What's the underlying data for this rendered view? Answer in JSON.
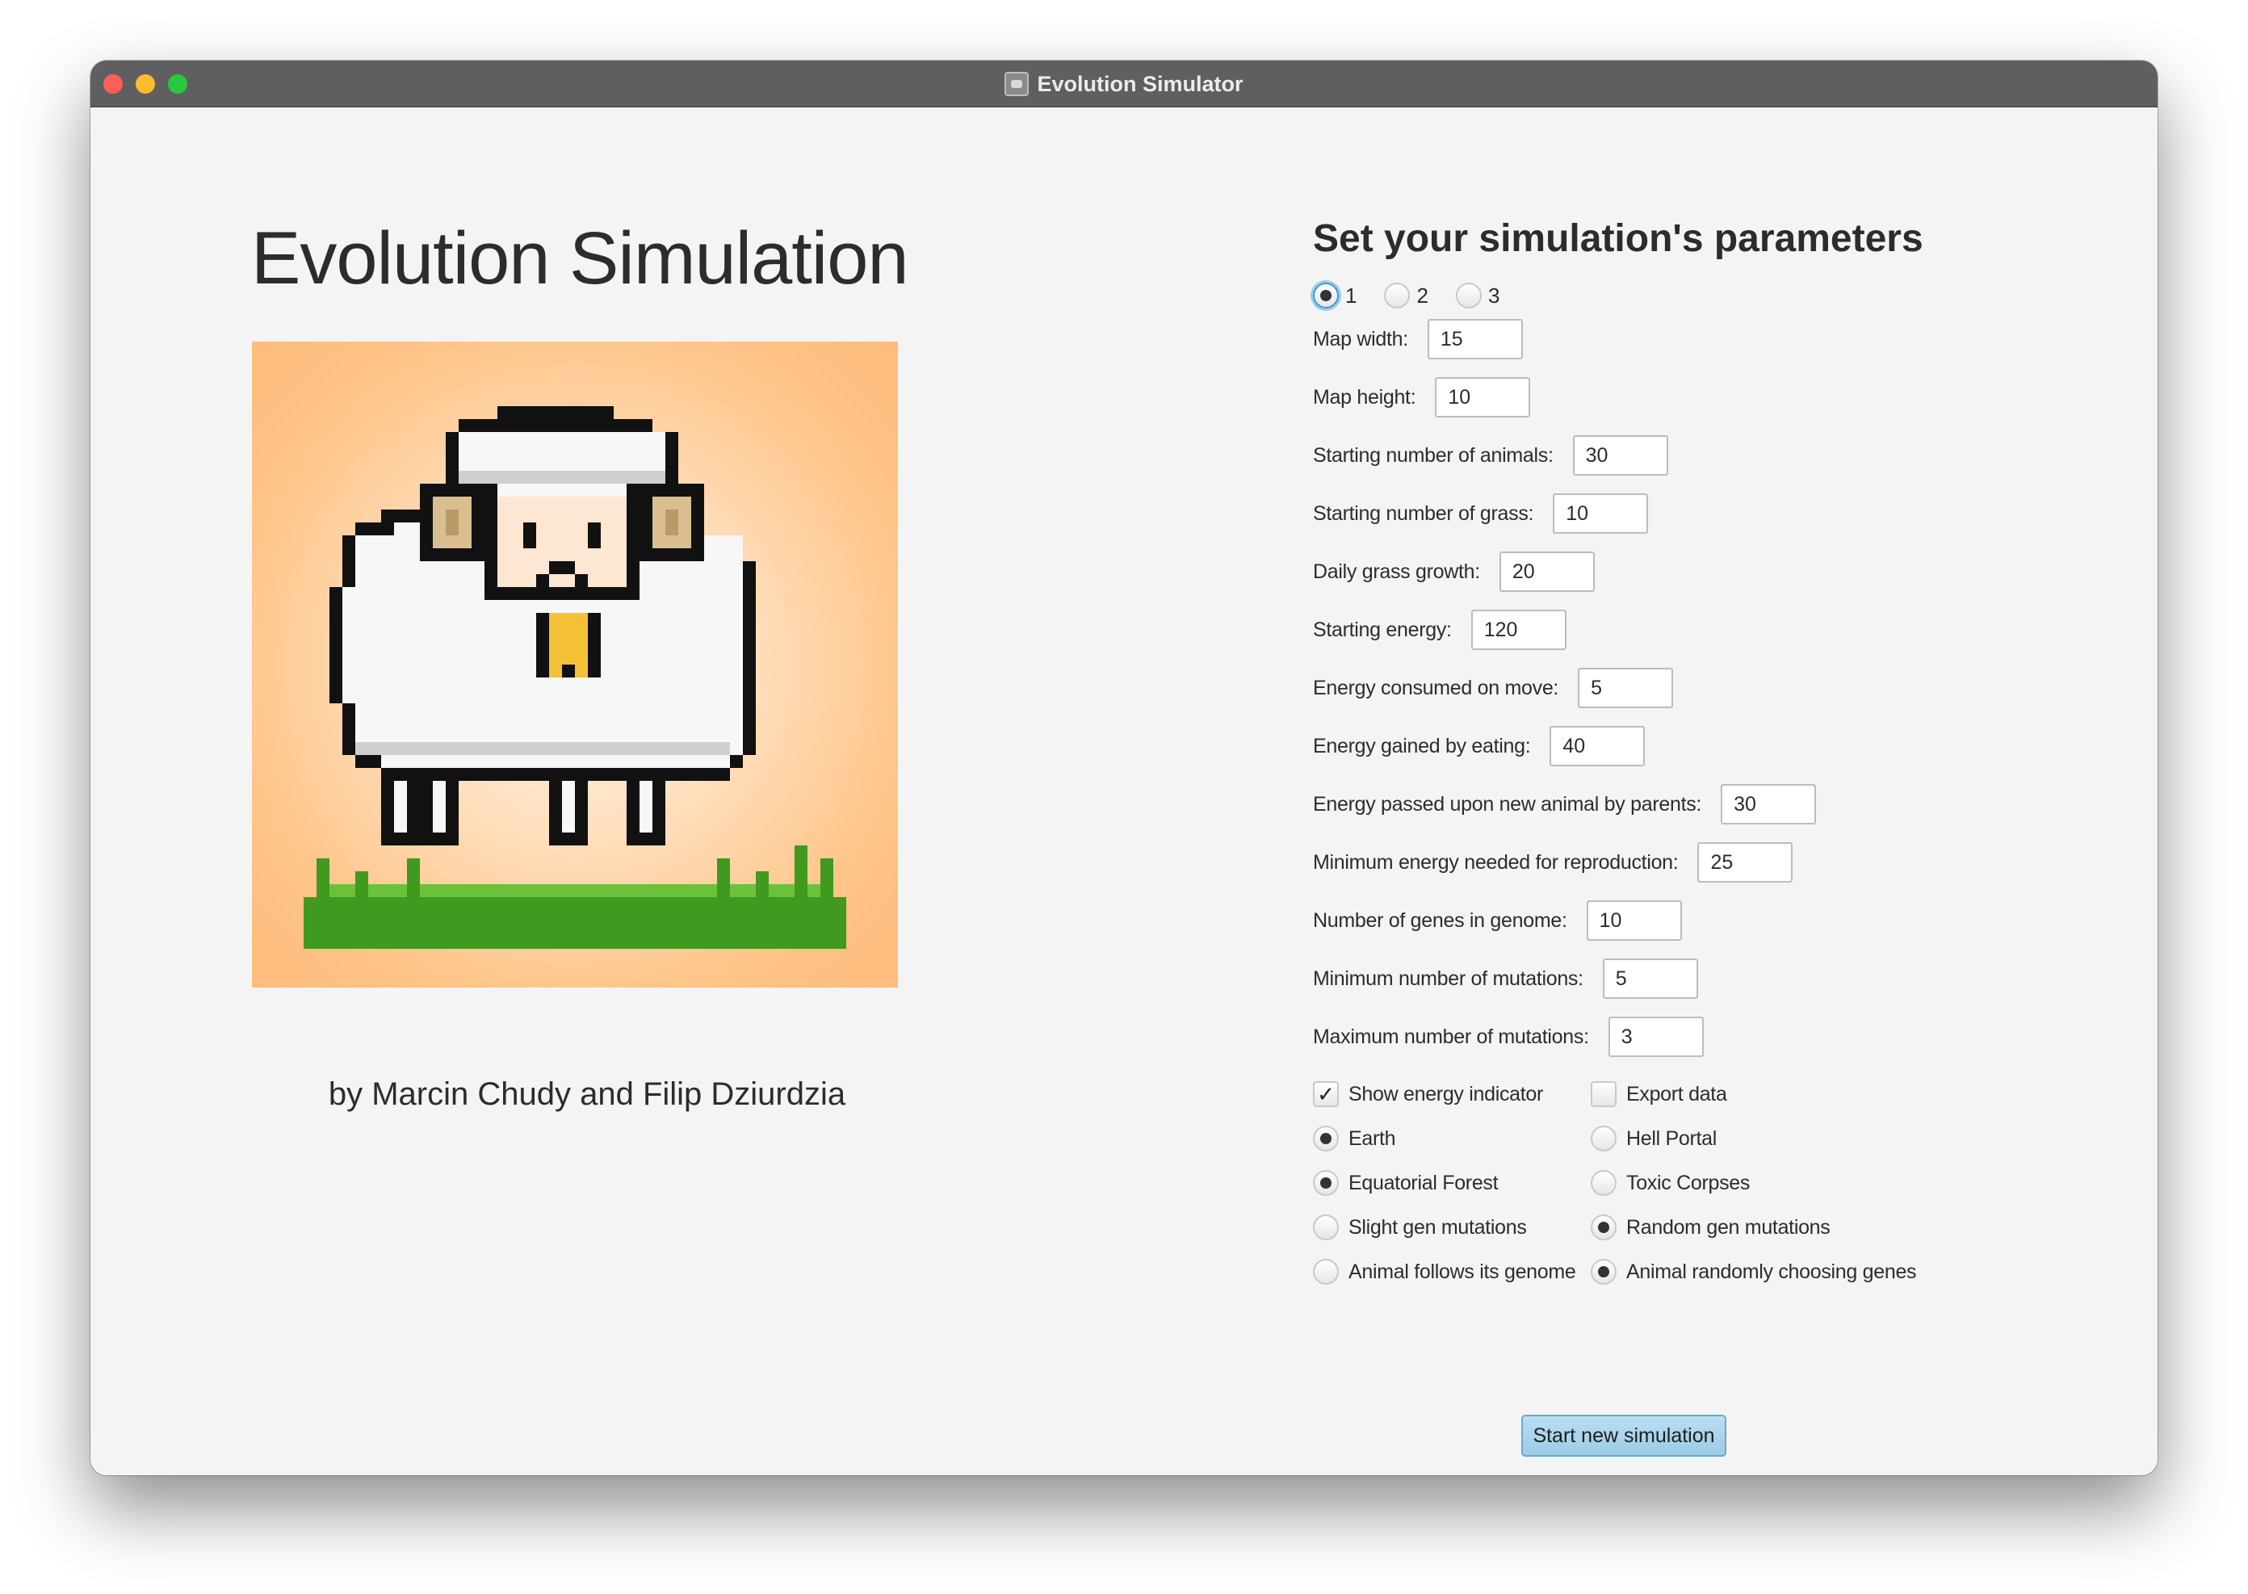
{
  "window": {
    "title": "Evolution Simulator"
  },
  "left": {
    "heading": "Evolution Simulation",
    "authors": "by Marcin Chudy and Filip Dziurdzia"
  },
  "params": {
    "heading": "Set your simulation's parameters",
    "presets": [
      {
        "label": "1",
        "selected": true
      },
      {
        "label": "2",
        "selected": false
      },
      {
        "label": "3",
        "selected": false
      }
    ],
    "fields": [
      {
        "label": "Map width:",
        "value": "15"
      },
      {
        "label": "Map height:",
        "value": "10"
      },
      {
        "label": "Starting number of animals:",
        "value": "30"
      },
      {
        "label": "Starting number of grass:",
        "value": "10"
      },
      {
        "label": "Daily grass growth:",
        "value": "20"
      },
      {
        "label": "Starting energy:",
        "value": "120"
      },
      {
        "label": "Energy consumed on move:",
        "value": "5"
      },
      {
        "label": "Energy gained by eating:",
        "value": "40"
      },
      {
        "label": "Energy passed upon new animal by parents:",
        "value": "30"
      },
      {
        "label": "Minimum energy needed for reproduction:",
        "value": "25"
      },
      {
        "label": "Number of genes in genome:",
        "value": "10"
      },
      {
        "label": "Minimum number of mutations:",
        "value": "5"
      },
      {
        "label": "Maximum number of mutations:",
        "value": "3"
      }
    ],
    "options": [
      {
        "left": {
          "label": "Show energy indicator",
          "kind": "checkbox",
          "checked": true
        },
        "right": {
          "label": "Export data",
          "kind": "checkbox",
          "checked": false
        }
      },
      {
        "left": {
          "label": "Earth",
          "kind": "radio",
          "checked": true
        },
        "right": {
          "label": "Hell Portal",
          "kind": "radio",
          "checked": false
        }
      },
      {
        "left": {
          "label": "Equatorial Forest",
          "kind": "radio",
          "checked": true
        },
        "right": {
          "label": "Toxic Corpses",
          "kind": "radio",
          "checked": false
        }
      },
      {
        "left": {
          "label": "Slight gen mutations",
          "kind": "radio",
          "checked": false
        },
        "right": {
          "label": "Random gen mutations",
          "kind": "radio",
          "checked": true
        }
      },
      {
        "left": {
          "label": "Animal follows its genome",
          "kind": "radio",
          "checked": false
        },
        "right": {
          "label": "Animal randomly choosing genes",
          "kind": "radio",
          "checked": true
        }
      }
    ],
    "start_button": "Start new simulation"
  },
  "colors": {
    "titlebar": "#5f5f61",
    "window_bg": "#f4f4f4",
    "button_bg": "#a9d3ec",
    "focus": "#3a9ad9"
  }
}
